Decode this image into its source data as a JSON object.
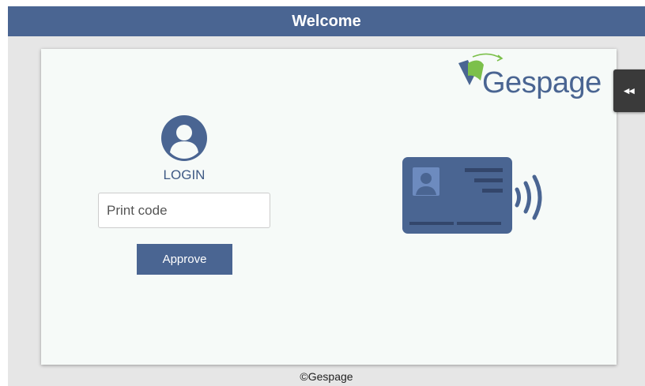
{
  "header": {
    "title": "Welcome"
  },
  "logo": {
    "text": "Gespage",
    "icon": "gespage-logo-icon"
  },
  "side_toggle": {
    "label": "◂◂",
    "icon": "double-chevron-left-icon"
  },
  "login": {
    "avatar_icon": "user-avatar-icon",
    "label": "LOGIN",
    "input": {
      "placeholder": "Print code",
      "value": ""
    },
    "approve_label": "Approve"
  },
  "card_reader": {
    "icon": "id-card-contactless-icon"
  },
  "footer": {
    "copyright": "©Gespage"
  },
  "colors": {
    "brand": "#4a6592",
    "background": "#e6e6e6",
    "panel": "#f6faf8"
  }
}
